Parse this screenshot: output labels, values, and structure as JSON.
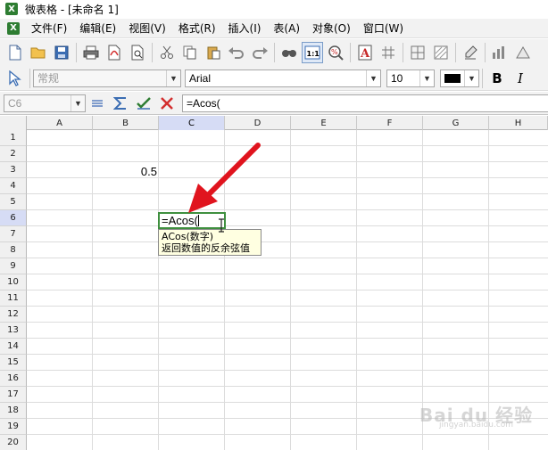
{
  "window": {
    "title": "微表格 - [未命名 1]",
    "app_icon_letter": "X"
  },
  "menubar": {
    "items": [
      "文件(F)",
      "编辑(E)",
      "视图(V)",
      "格式(R)",
      "插入(I)",
      "表(A)",
      "对象(O)",
      "窗口(W)"
    ]
  },
  "toolbar": {
    "buttons": [
      "new-icon",
      "open-icon",
      "save-icon",
      "print-icon",
      "pdf-icon",
      "print-preview-icon",
      "cut-icon",
      "copy-icon",
      "paste-icon",
      "undo-icon",
      "redo-icon",
      "find-icon",
      "actual-size-icon",
      "zoom-icon",
      "font-color-icon",
      "grid-icon",
      "borders-icon",
      "fill-icon",
      "clear-format-icon",
      "chart-icon",
      "more-icon"
    ],
    "zoom_label": "1:1"
  },
  "formatbar": {
    "style_value": "常规",
    "font_value": "Arial",
    "size_value": "10",
    "bold_label": "B",
    "italic_label": "I",
    "font_color": "#000000"
  },
  "inputbar": {
    "cell_ref": "C6",
    "formula": "=Acos("
  },
  "sheet": {
    "columns": [
      "A",
      "B",
      "C",
      "D",
      "E",
      "F",
      "G",
      "H"
    ],
    "active_column": "C",
    "rows": [
      "1",
      "2",
      "3",
      "4",
      "5",
      "6",
      "7",
      "8",
      "9",
      "10",
      "11",
      "12",
      "13",
      "14",
      "15",
      "16",
      "17",
      "18",
      "19",
      "20"
    ],
    "active_row": "6",
    "b3_value": "0.5",
    "editing_text": "=Acos(",
    "tooltip_line1": "ACos(数字)",
    "tooltip_line2": "返回数值的反余弦值"
  },
  "colors": {
    "accent_green": "#3f8f3f",
    "arrow_red": "#e0141e",
    "active_header": "#d6dcf5"
  },
  "watermark": {
    "text": "Bai du 经验",
    "sub": "jingyan.baidu.com"
  }
}
